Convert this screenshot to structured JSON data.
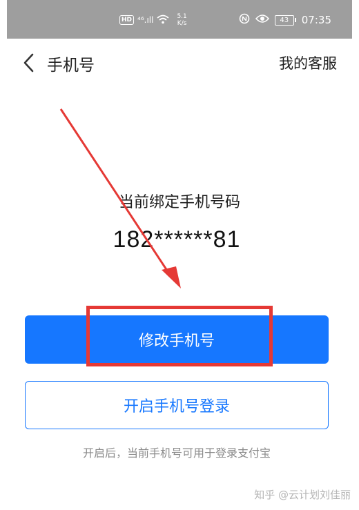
{
  "status_bar": {
    "hd": "HD",
    "signal": "⁴⁶.ıll",
    "net_speed_value": "5.1",
    "net_speed_unit": "K/s",
    "time": "07:35",
    "battery": "43"
  },
  "header": {
    "title": "手机号",
    "service_link": "我的客服"
  },
  "main": {
    "bound_label": "当前绑定手机号码",
    "phone_number": "182******81",
    "modify_button": "修改手机号",
    "enable_login_button": "开启手机号登录",
    "hint": "开启后，当前手机号可用于登录支付宝"
  },
  "watermark": "知乎 @云计划刘佳丽",
  "colors": {
    "accent": "#1677ff",
    "annotation": "#e53935",
    "status_bar": "#9e9e9e"
  },
  "icons": {
    "back": "chevron-left-icon",
    "wifi": "wifi-icon",
    "eye": "eye-icon",
    "nfc": "nfc-icon"
  }
}
